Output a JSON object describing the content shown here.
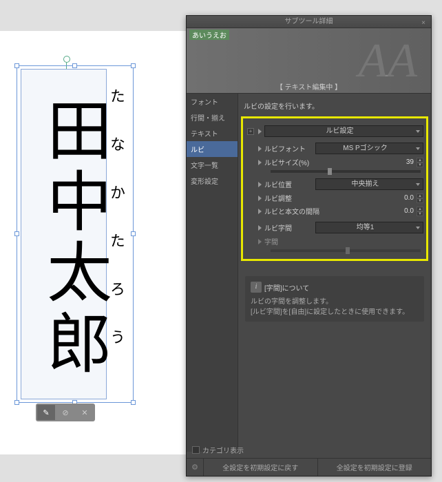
{
  "canvas": {
    "mainText": "田中太郎",
    "rubyText": "たなかたろう"
  },
  "panel": {
    "title": "サブツール詳細",
    "brushName": "あいうえお",
    "editMode": "【 テキスト編集中 】"
  },
  "categories": [
    "フォント",
    "行間・揃え",
    "テキスト",
    "ルビ",
    "文字一覧",
    "変形設定"
  ],
  "selectedCategory": "ルビ",
  "description": "ルビの設定を行います。",
  "settings": {
    "header": "ルビ設定",
    "font": {
      "label": "ルビフォント",
      "value": "MS Pゴシック"
    },
    "size": {
      "label": "ルビサイズ(%)",
      "value": "39"
    },
    "pos": {
      "label": "ルビ位置",
      "value": "中央揃え"
    },
    "adjust": {
      "label": "ルビ調整",
      "value": "0.0"
    },
    "gap": {
      "label": "ルビと本文の間隔",
      "value": "0.0"
    },
    "spacing": {
      "label": "ルビ字間",
      "value": "均等1"
    },
    "charSpace": {
      "label": "字間"
    }
  },
  "info": {
    "title": "[字間]について",
    "line1": "ルビの字間を調整します。",
    "line2": "[ルビ字間]を[自由]に設定したときに使用できます。"
  },
  "footer": {
    "categoryShow": "カテゴリ表示",
    "reset": "全設定を初期設定に戻す",
    "register": "全設定を初期設定に登録"
  }
}
